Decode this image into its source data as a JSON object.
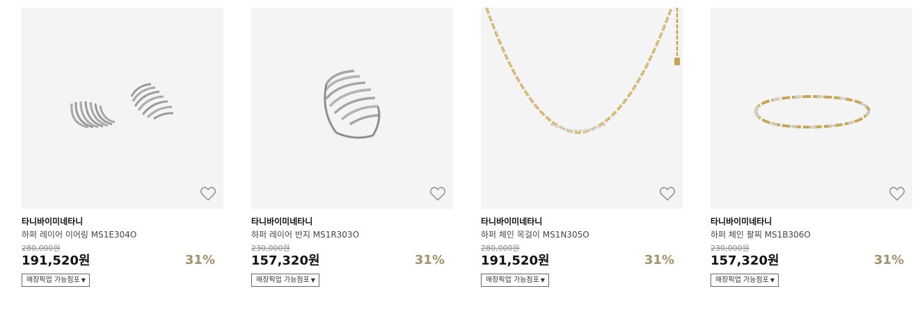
{
  "products": [
    {
      "brand": "타니바이미네타니",
      "name": "하퍼 레이어 이어링 MS1E304O",
      "original_price": "280,000원",
      "sale_price": "191,520원",
      "discount": "31%",
      "pickup_label": "매장픽업 가능점포",
      "image_icon": "earring-image"
    },
    {
      "brand": "타니바이미네타니",
      "name": "하퍼 레이어 반지 MS1R303O",
      "original_price": "230,000원",
      "sale_price": "157,320원",
      "discount": "31%",
      "pickup_label": "매장픽업 가능점포",
      "image_icon": "ring-image"
    },
    {
      "brand": "타니바이미네타니",
      "name": "하퍼 체인 목걸이 MS1N305O",
      "original_price": "280,000원",
      "sale_price": "191,520원",
      "discount": "31%",
      "pickup_label": "매장픽업 가능점포",
      "image_icon": "necklace-image"
    },
    {
      "brand": "타니바이미네타니",
      "name": "하퍼 체인 팔찌 MS1B306O",
      "original_price": "230,000원",
      "sale_price": "157,320원",
      "discount": "31%",
      "pickup_label": "매장픽업 가능점포",
      "image_icon": "bracelet-image"
    }
  ],
  "colors": {
    "discount": "#a2926b",
    "image_background": "#f4f4f4",
    "gold": "#c9a453",
    "silver": "#b8b8b8"
  }
}
